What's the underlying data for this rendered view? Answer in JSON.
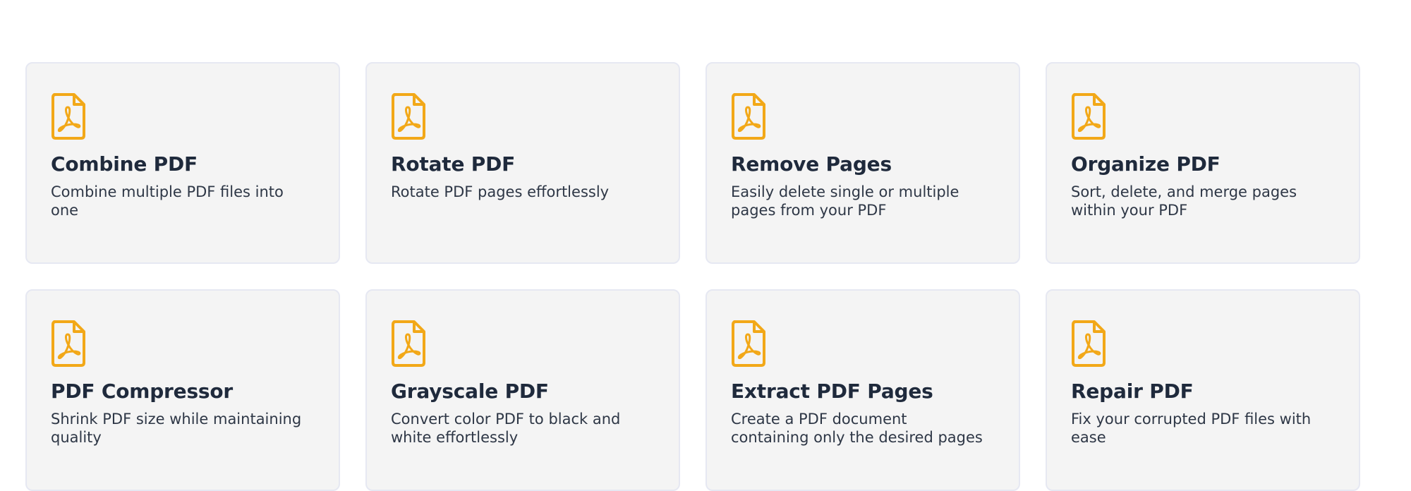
{
  "tools": [
    {
      "id": "combine-pdf",
      "title": "Combine PDF",
      "description": "Combine multiple PDF files into one",
      "icon": "pdf-file-icon"
    },
    {
      "id": "rotate-pdf",
      "title": "Rotate PDF",
      "description": "Rotate PDF pages effortlessly",
      "icon": "pdf-file-icon"
    },
    {
      "id": "remove-pages",
      "title": "Remove Pages",
      "description": "Easily delete single or multiple pages from your PDF",
      "icon": "pdf-file-icon"
    },
    {
      "id": "organize-pdf",
      "title": "Organize PDF",
      "description": "Sort, delete, and merge pages within your PDF",
      "icon": "pdf-file-icon"
    },
    {
      "id": "pdf-compressor",
      "title": "PDF Compressor",
      "description": "Shrink PDF size while maintaining quality",
      "icon": "pdf-file-icon"
    },
    {
      "id": "grayscale-pdf",
      "title": "Grayscale PDF",
      "description": "Convert color PDF to black and white effortlessly",
      "icon": "pdf-file-icon"
    },
    {
      "id": "extract-pdf-pages",
      "title": "Extract PDF Pages",
      "description": "Create a PDF document containing only the desired pages",
      "icon": "pdf-file-icon"
    },
    {
      "id": "repair-pdf",
      "title": "Repair PDF",
      "description": "Fix your corrupted PDF files with ease",
      "icon": "pdf-file-icon"
    }
  ],
  "colors": {
    "icon": "#f2a818",
    "card_background": "#f4f4f4",
    "card_border": "#e6e8f2",
    "title": "#1f2a3c",
    "description": "#2e3746"
  }
}
